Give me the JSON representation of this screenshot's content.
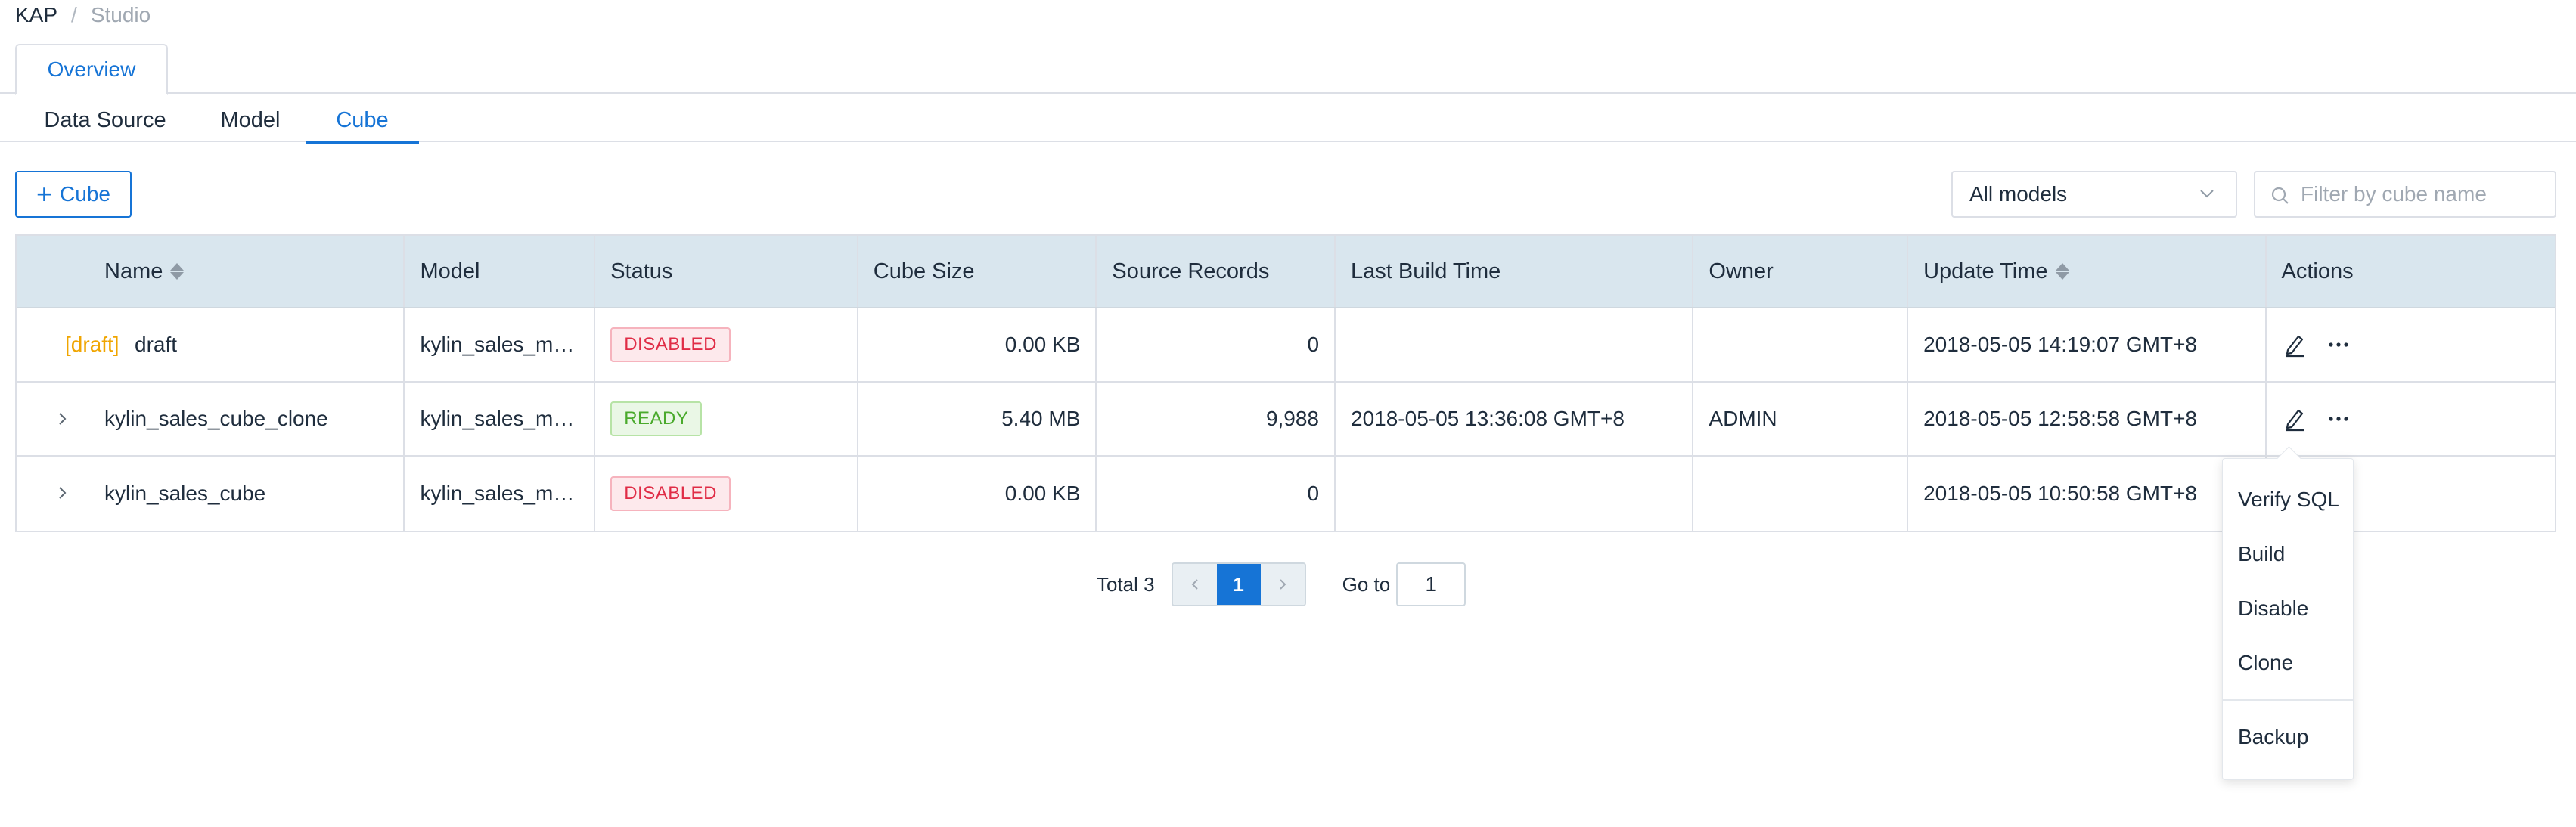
{
  "breadcrumb": {
    "root": "KAP",
    "separator": "/",
    "current": "Studio"
  },
  "top_tabs": {
    "overview": "Overview"
  },
  "sub_tabs": {
    "data_source": "Data Source",
    "model": "Model",
    "cube": "Cube",
    "active": "Cube"
  },
  "toolbar": {
    "add_cube_label": "Cube",
    "model_select_value": "All models",
    "filter_placeholder": "Filter by cube name"
  },
  "table": {
    "columns": {
      "name": "Name",
      "model": "Model",
      "status": "Status",
      "cube_size": "Cube Size",
      "source_records": "Source Records",
      "last_build_time": "Last Build Time",
      "owner": "Owner",
      "update_time": "Update Time",
      "actions": "Actions"
    },
    "rows": [
      {
        "draft_tag": "[draft]",
        "name": "draft",
        "model": "kylin_sales_m…",
        "status": "DISABLED",
        "cube_size": "0.00 KB",
        "source_records": "0",
        "last_build_time": "",
        "owner": "",
        "update_time": "2018-05-05 14:19:07 GMT+8"
      },
      {
        "draft_tag": "",
        "name": "kylin_sales_cube_clone",
        "model": "kylin_sales_m…",
        "status": "READY",
        "cube_size": "5.40 MB",
        "source_records": "9,988",
        "last_build_time": "2018-05-05 13:36:08 GMT+8",
        "owner": "ADMIN",
        "update_time": "2018-05-05 12:58:58 GMT+8"
      },
      {
        "draft_tag": "",
        "name": "kylin_sales_cube",
        "model": "kylin_sales_m…",
        "status": "DISABLED",
        "cube_size": "0.00 KB",
        "source_records": "0",
        "last_build_time": "",
        "owner": "",
        "update_time": "2018-05-05 10:50:58 GMT+8"
      }
    ]
  },
  "pagination": {
    "total_label": "Total 3",
    "current_page": "1",
    "goto_label": "Go to",
    "goto_value": "1"
  },
  "action_menu": {
    "items": [
      "Verify SQL",
      "Build",
      "Disable",
      "Clone",
      "Backup"
    ]
  },
  "colors": {
    "accent": "#1674d6",
    "header_bg": "#d9e6ee",
    "draft": "#f0a500",
    "danger": "#e02c46",
    "success": "#4aaa2c"
  },
  "icons": [
    "plus-icon",
    "chevron-down-icon",
    "search-icon",
    "sort-icon",
    "expand-arrow-icon",
    "edit-icon",
    "more-icon",
    "arrow-left-icon",
    "arrow-right-icon"
  ]
}
